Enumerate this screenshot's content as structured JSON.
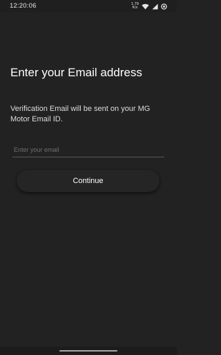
{
  "status_bar": {
    "time": "12:20:06",
    "net_speed_value": "1.79",
    "net_speed_unit": "K/s",
    "icons": [
      "wifi-icon",
      "signal-icon",
      "battery-icon"
    ]
  },
  "screen": {
    "title": "Enter your Email address",
    "subtitle": "Verification Email will be sent on your MG Motor Email ID.",
    "email_field": {
      "placeholder": "Enter your email",
      "value": ""
    },
    "continue_label": "Continue"
  },
  "colors": {
    "background": "#222222",
    "text": "#ffffff",
    "placeholder": "#6f6f6f",
    "underline": "#5a5a5a"
  }
}
